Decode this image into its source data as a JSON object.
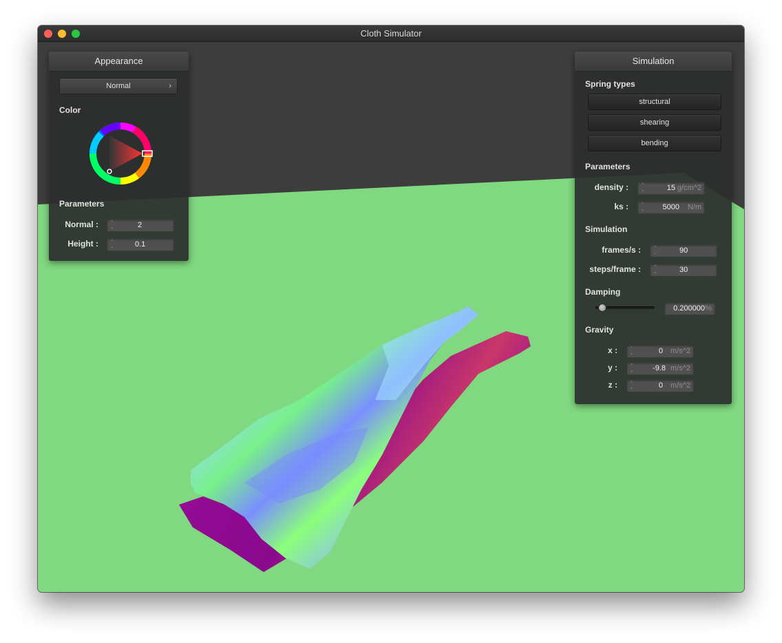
{
  "window": {
    "title": "Cloth Simulator"
  },
  "appearance": {
    "title": "Appearance",
    "shader_value": "Normal",
    "color_label": "Color",
    "color_wheel_icon": "color-wheel-icon",
    "parameters_label": "Parameters",
    "normal": {
      "label": "Normal :",
      "value": "2"
    },
    "height": {
      "label": "Height :",
      "value": "0.1"
    }
  },
  "simulation": {
    "title": "Simulation",
    "spring_types_label": "Spring types",
    "buttons": {
      "structural": "structural",
      "shearing": "shearing",
      "bending": "bending"
    },
    "parameters_label": "Parameters",
    "density": {
      "label": "density :",
      "value": "15",
      "unit": "g/cm^2"
    },
    "ks": {
      "label": "ks :",
      "value": "5000",
      "unit": "N/m"
    },
    "simulation_label": "Simulation",
    "fps": {
      "label": "frames/s :",
      "value": "90"
    },
    "steps": {
      "label": "steps/frame :",
      "value": "30"
    },
    "damping_label": "Damping",
    "damping": {
      "value": "0.200000",
      "unit": "%",
      "slider_fraction": 0.2
    },
    "gravity_label": "Gravity",
    "gx": {
      "label": "x :",
      "value": "0",
      "unit": "m/s^2"
    },
    "gy": {
      "label": "y :",
      "value": "-9.8",
      "unit": "m/s^2"
    },
    "gz": {
      "label": "z :",
      "value": "0",
      "unit": "m/s^2"
    }
  },
  "colors": {
    "floor": "#80d980",
    "background": "#3d3d3d",
    "panel": "#2c2e2d",
    "cloth_front": "#7dfb7a",
    "cloth_back": "#8d0a8e"
  }
}
